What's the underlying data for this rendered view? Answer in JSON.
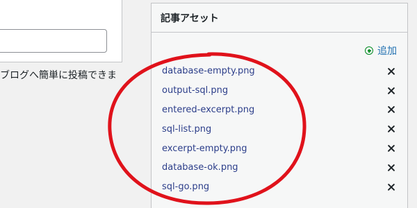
{
  "left": {
    "description": "ブログへ簡単に投稿できま"
  },
  "panel": {
    "title": "記事アセット",
    "add_label": "追加",
    "assets": [
      {
        "name": "database-empty.png"
      },
      {
        "name": "output-sql.png"
      },
      {
        "name": "entered-excerpt.png"
      },
      {
        "name": "sql-list.png"
      },
      {
        "name": "excerpt-empty.png"
      },
      {
        "name": "database-ok.png"
      },
      {
        "name": "sql-go.png"
      }
    ]
  },
  "colors": {
    "link": "#2c3e8a",
    "add_icon": "#008a20",
    "highlight": "#e0121b",
    "panel_bg": "#f6f7f7",
    "border": "#c3c4c7"
  },
  "icons": {
    "add": "plus-circle-icon",
    "remove": "close-icon"
  }
}
